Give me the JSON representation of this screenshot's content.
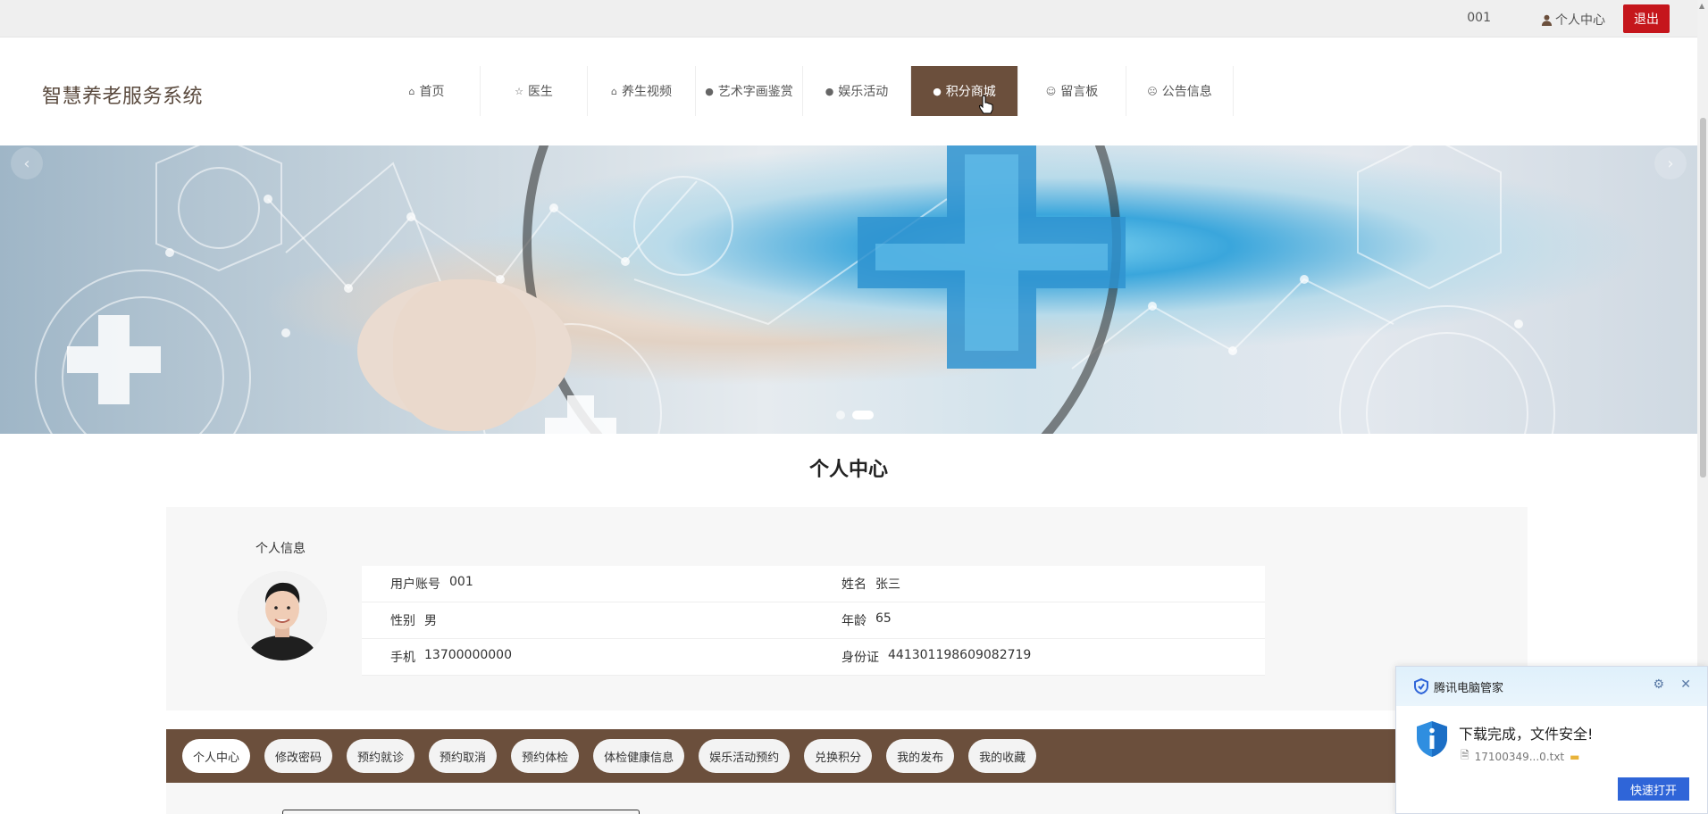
{
  "topbar": {
    "account": "001",
    "profile_link": "个人中心",
    "logout": "退出"
  },
  "brand": "智慧养老服务系统",
  "nav": [
    {
      "label": "首页",
      "icon": "⌂"
    },
    {
      "label": "医生",
      "icon": "☆"
    },
    {
      "label": "养生视频",
      "icon": "⌂"
    },
    {
      "label": "艺术字画鉴赏",
      "icon": "●"
    },
    {
      "label": "娱乐活动",
      "icon": "●"
    },
    {
      "label": "积分商城",
      "icon": "●",
      "active": true
    },
    {
      "label": "留言板",
      "icon": "☺"
    },
    {
      "label": "公告信息",
      "icon": "☹"
    }
  ],
  "banner": {
    "prev": "‹",
    "next": "›"
  },
  "page_title": "个人中心",
  "profile": {
    "section_label": "个人信息",
    "fields": [
      [
        {
          "label": "用户账号",
          "value": "001"
        },
        {
          "label": "姓名",
          "value": "张三"
        }
      ],
      [
        {
          "label": "性别",
          "value": "男"
        },
        {
          "label": "年龄",
          "value": "65"
        }
      ],
      [
        {
          "label": "手机",
          "value": "13700000000"
        },
        {
          "label": "身份证",
          "value": "441301198609082719"
        }
      ]
    ]
  },
  "tabs": [
    "个人中心",
    "修改密码",
    "预约就诊",
    "预约取消",
    "预约体检",
    "体检健康信息",
    "娱乐活动预约",
    "兑换积分",
    "我的发布",
    "我的收藏"
  ],
  "popup": {
    "title": "腾讯电脑管家",
    "message": "下载完成，文件安全!",
    "file": "17100349...0.txt",
    "button": "快速打开",
    "accent": "#2f65d8"
  },
  "colors": {
    "nav_active": "#6b4f3c",
    "logout": "#c5161c"
  }
}
